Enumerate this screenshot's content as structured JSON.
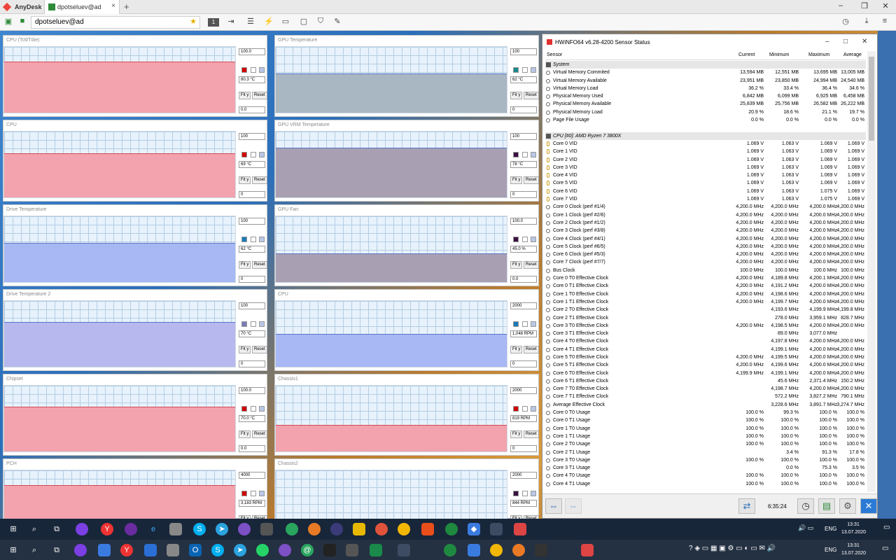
{
  "anydesk": {
    "app_name": "AnyDesk",
    "tab_label": "dpotseluev@ad",
    "address": "dpotseluev@ad",
    "counter": "1"
  },
  "tiles_left": [
    {
      "title": "CPU (Tctl/Tdie)",
      "max": "100.0",
      "current": "80.3 °C",
      "min": "0.0",
      "fit": "Fit y",
      "reset": "Reset",
      "level": 0.78,
      "color": "#f2a3ad",
      "swatch": "#d00000"
    },
    {
      "title": "CPU",
      "max": "100",
      "current": "69 °C",
      "min": "0",
      "fit": "Fit y",
      "reset": "Reset",
      "level": 0.67,
      "color": "#f2a3ad",
      "swatch": "#d00000"
    },
    {
      "title": "Drive Temperature",
      "max": "100",
      "current": "62 °C",
      "min": "0",
      "fit": "Fit y",
      "reset": "Reset",
      "level": 0.6,
      "color": "#a7b8f4",
      "swatch": "#1a7ab8"
    },
    {
      "title": "Drive Temperature 2",
      "max": "100",
      "current": "70 °C",
      "min": "0",
      "fit": "Fit y",
      "reset": "Reset",
      "level": 0.68,
      "color": "#b7b9ee",
      "swatch": "#7a7ab8"
    },
    {
      "title": "Chipset",
      "max": "100.0",
      "current": "70.0 °C",
      "min": "0.0",
      "fit": "Fit y",
      "reset": "Reset",
      "level": 0.68,
      "color": "#f2a3ad",
      "swatch": "#d00000"
    },
    {
      "title": "PCH",
      "max": "4000",
      "current": "3,183 RPM",
      "min": "0",
      "fit": "Fit y",
      "reset": "Reset",
      "level": 0.78,
      "color": "#f2a3ad",
      "swatch": "#d00000"
    }
  ],
  "tiles_right": [
    {
      "title": "GPU Temperature",
      "max": "100",
      "current": "62 °C",
      "min": "0",
      "fit": "Fit y",
      "reset": "Reset",
      "level": 0.6,
      "color": "#a9b7c2",
      "swatch": "#1a8a8a"
    },
    {
      "title": "GPU VRM Temperature",
      "max": "100",
      "current": "78 °C",
      "min": "0",
      "fit": "Fit y",
      "reset": "Reset",
      "level": 0.76,
      "color": "#a8a0b2",
      "swatch": "#3a1040"
    },
    {
      "title": "GPU Fan",
      "max": "100.0",
      "current": "45.0 %",
      "min": "0.0",
      "fit": "Fit y",
      "reset": "Reset",
      "level": 0.44,
      "color": "#a8a0b2",
      "swatch": "#3a1040"
    },
    {
      "title": "CPU",
      "max": "2000",
      "current": "1,048 RPM",
      "min": "0",
      "fit": "Fit y",
      "reset": "Reset",
      "level": 0.5,
      "color": "#a7b8f4",
      "swatch": "#1a7ab8"
    },
    {
      "title": "Chassis1",
      "max": "2000",
      "current": "819 RPM",
      "min": "0",
      "fit": "Fit y",
      "reset": "Reset",
      "level": 0.4,
      "color": "#f2a3ad",
      "swatch": "#d00000"
    },
    {
      "title": "Chassis2",
      "max": "2000",
      "current": "844 RPM",
      "min": "0",
      "fit": "Fit y",
      "reset": "Reset",
      "level": 0.14,
      "color": "#a8a0b2",
      "swatch": "#3a1040"
    }
  ],
  "hwinfo": {
    "title": "HWiNFO64 v6.28-4200 Sensor Status",
    "columns": [
      "Sensor",
      "Current",
      "Minimum",
      "Maximum",
      "Average"
    ],
    "rows": [
      {
        "type": "group",
        "name": "System"
      },
      {
        "icon": "c",
        "name": "Virtual Memory Commited",
        "cur": "13,594 MB",
        "min": "12,551 MB",
        "max": "13,695 MB",
        "avg": "13,005 MB"
      },
      {
        "icon": "c",
        "name": "Virtual Memory Available",
        "cur": "23,951 MB",
        "min": "23,850 MB",
        "max": "24,994 MB",
        "avg": "24,540 MB"
      },
      {
        "icon": "c",
        "name": "Virtual Memory Load",
        "cur": "36.2 %",
        "min": "33.4 %",
        "max": "36.4 %",
        "avg": "34.6 %"
      },
      {
        "icon": "c",
        "name": "Physical Memory Used",
        "cur": "6,842 MB",
        "min": "6,099 MB",
        "max": "6,925 MB",
        "avg": "6,458 MB"
      },
      {
        "icon": "c",
        "name": "Physical Memory Available",
        "cur": "25,839 MB",
        "min": "25,756 MB",
        "max": "26,582 MB",
        "avg": "26,222 MB"
      },
      {
        "icon": "c",
        "name": "Physical Memory Load",
        "cur": "20.9 %",
        "min": "18.6 %",
        "max": "21.1 %",
        "avg": "19.7 %"
      },
      {
        "icon": "c",
        "name": "Page File Usage",
        "cur": "0.0 %",
        "min": "0.0 %",
        "max": "0.0 %",
        "avg": "0.0 %"
      },
      {
        "type": "gap"
      },
      {
        "type": "group",
        "name": "CPU [#0]: AMD Ryzen 7 3800X"
      },
      {
        "icon": "v",
        "name": "Core 0 VID",
        "cur": "1.069 V",
        "min": "1.063 V",
        "max": "1.069 V",
        "avg": "1.069 V"
      },
      {
        "icon": "v",
        "name": "Core 1 VID",
        "cur": "1.069 V",
        "min": "1.063 V",
        "max": "1.069 V",
        "avg": "1.069 V"
      },
      {
        "icon": "v",
        "name": "Core 2 VID",
        "cur": "1.069 V",
        "min": "1.063 V",
        "max": "1.069 V",
        "avg": "1.069 V"
      },
      {
        "icon": "v",
        "name": "Core 3 VID",
        "cur": "1.069 V",
        "min": "1.063 V",
        "max": "1.069 V",
        "avg": "1.069 V"
      },
      {
        "icon": "v",
        "name": "Core 4 VID",
        "cur": "1.069 V",
        "min": "1.063 V",
        "max": "1.069 V",
        "avg": "1.069 V"
      },
      {
        "icon": "v",
        "name": "Core 5 VID",
        "cur": "1.069 V",
        "min": "1.063 V",
        "max": "1.069 V",
        "avg": "1.069 V"
      },
      {
        "icon": "v",
        "name": "Core 6 VID",
        "cur": "1.069 V",
        "min": "1.063 V",
        "max": "1.075 V",
        "avg": "1.069 V"
      },
      {
        "icon": "v",
        "name": "Core 7 VID",
        "cur": "1.069 V",
        "min": "1.063 V",
        "max": "1.075 V",
        "avg": "1.069 V"
      },
      {
        "icon": "c",
        "name": "Core 0 Clock (perf #1/4)",
        "cur": "4,200.0 MHz",
        "min": "4,200.0 MHz",
        "max": "4,200.0 MHz",
        "avg": "4,200.0 MHz"
      },
      {
        "icon": "c",
        "name": "Core 1 Clock (perf #2/6)",
        "cur": "4,200.0 MHz",
        "min": "4,200.0 MHz",
        "max": "4,200.0 MHz",
        "avg": "4,200.0 MHz"
      },
      {
        "icon": "c",
        "name": "Core 2 Clock (perf #1/2)",
        "cur": "4,200.0 MHz",
        "min": "4,200.0 MHz",
        "max": "4,200.0 MHz",
        "avg": "4,200.0 MHz"
      },
      {
        "icon": "c",
        "name": "Core 3 Clock (perf #3/8)",
        "cur": "4,200.0 MHz",
        "min": "4,200.0 MHz",
        "max": "4,200.0 MHz",
        "avg": "4,200.0 MHz"
      },
      {
        "icon": "c",
        "name": "Core 4 Clock (perf #4/1)",
        "cur": "4,200.0 MHz",
        "min": "4,200.0 MHz",
        "max": "4,200.0 MHz",
        "avg": "4,200.0 MHz"
      },
      {
        "icon": "c",
        "name": "Core 5 Clock (perf #6/5)",
        "cur": "4,200.0 MHz",
        "min": "4,200.0 MHz",
        "max": "4,200.0 MHz",
        "avg": "4,200.0 MHz"
      },
      {
        "icon": "c",
        "name": "Core 6 Clock (perf #5/3)",
        "cur": "4,200.0 MHz",
        "min": "4,200.0 MHz",
        "max": "4,200.0 MHz",
        "avg": "4,200.0 MHz"
      },
      {
        "icon": "c",
        "name": "Core 7 Clock (perf #7/7)",
        "cur": "4,200.0 MHz",
        "min": "4,200.0 MHz",
        "max": "4,200.0 MHz",
        "avg": "4,200.0 MHz"
      },
      {
        "icon": "c",
        "name": "Bus Clock",
        "cur": "100.0 MHz",
        "min": "100.0 MHz",
        "max": "100.0 MHz",
        "avg": "100.0 MHz"
      },
      {
        "icon": "c",
        "name": "Core 0 T0 Effective Clock",
        "cur": "4,200.0 MHz",
        "min": "4,189.8 MHz",
        "max": "4,200.1 MHz",
        "avg": "4,200.0 MHz"
      },
      {
        "icon": "c",
        "name": "Core 0 T1 Effective Clock",
        "cur": "4,200.0 MHz",
        "min": "4,191.2 MHz",
        "max": "4,200.0 MHz",
        "avg": "4,200.0 MHz"
      },
      {
        "icon": "c",
        "name": "Core 1 T0 Effective Clock",
        "cur": "4,200.0 MHz",
        "min": "4,198.6 MHz",
        "max": "4,200.0 MHz",
        "avg": "4,200.0 MHz"
      },
      {
        "icon": "c",
        "name": "Core 1 T1 Effective Clock",
        "cur": "4,200.0 MHz",
        "min": "4,199.7 MHz",
        "max": "4,200.0 MHz",
        "avg": "4,200.0 MHz"
      },
      {
        "icon": "c",
        "name": "Core 2 T0 Effective Clock",
        "cur": "",
        "min": "4,193.6 MHz",
        "max": "4,199.9 MHz",
        "avg": "4,199.8 MHz"
      },
      {
        "icon": "c",
        "name": "Core 2 T1 Effective Clock",
        "cur": "",
        "min": "278.0 MHz",
        "max": "3,959.1 MHz",
        "avg": "828.7 MHz"
      },
      {
        "icon": "c",
        "name": "Core 3 T0 Effective Clock",
        "cur": "4,200.0 MHz",
        "min": "4,198.5 MHz",
        "max": "4,200.0 MHz",
        "avg": "4,200.0 MHz"
      },
      {
        "icon": "c",
        "name": "Core 3 T1 Effective Clock",
        "cur": "",
        "min": "89.0 MHz",
        "max": "3,077.0 MHz",
        "avg": ""
      },
      {
        "icon": "c",
        "name": "Core 4 T0 Effective Clock",
        "cur": "",
        "min": "4,197.8 MHz",
        "max": "4,200.0 MHz",
        "avg": "4,200.0 MHz"
      },
      {
        "icon": "c",
        "name": "Core 4 T1 Effective Clock",
        "cur": "",
        "min": "4,199.1 MHz",
        "max": "4,200.0 MHz",
        "avg": "4,200.0 MHz"
      },
      {
        "icon": "c",
        "name": "Core 5 T0 Effective Clock",
        "cur": "4,200.0 MHz",
        "min": "4,199.5 MHz",
        "max": "4,200.0 MHz",
        "avg": "4,200.0 MHz"
      },
      {
        "icon": "c",
        "name": "Core 5 T1 Effective Clock",
        "cur": "4,200.0 MHz",
        "min": "4,199.6 MHz",
        "max": "4,200.0 MHz",
        "avg": "4,200.0 MHz"
      },
      {
        "icon": "c",
        "name": "Core 6 T0 Effective Clock",
        "cur": "4,199.9 MHz",
        "min": "4,199.1 MHz",
        "max": "4,200.0 MHz",
        "avg": "4,200.0 MHz"
      },
      {
        "icon": "c",
        "name": "Core 6 T1 Effective Clock",
        "cur": "",
        "min": "45.6 MHz",
        "max": "2,371.4 MHz",
        "avg": "150.2 MHz"
      },
      {
        "icon": "c",
        "name": "Core 7 T0 Effective Clock",
        "cur": "",
        "min": "4,198.7 MHz",
        "max": "4,200.0 MHz",
        "avg": "4,200.0 MHz"
      },
      {
        "icon": "c",
        "name": "Core 7 T1 Effective Clock",
        "cur": "",
        "min": "572.2 MHz",
        "max": "3,827.2 MHz",
        "avg": "790.1 MHz"
      },
      {
        "icon": "c",
        "name": "Average Effective Clock",
        "cur": "",
        "min": "3,228.6 MHz",
        "max": "3,891.7 MHz",
        "avg": "3,274.7 MHz"
      },
      {
        "icon": "c",
        "name": "Core 0 T0 Usage",
        "cur": "100.0 %",
        "min": "99.3 %",
        "max": "100.0 %",
        "avg": "100.0 %"
      },
      {
        "icon": "c",
        "name": "Core 0 T1 Usage",
        "cur": "100.0 %",
        "min": "100.0 %",
        "max": "100.0 %",
        "avg": "100.0 %"
      },
      {
        "icon": "c",
        "name": "Core 1 T0 Usage",
        "cur": "100.0 %",
        "min": "100.0 %",
        "max": "100.0 %",
        "avg": "100.0 %"
      },
      {
        "icon": "c",
        "name": "Core 1 T1 Usage",
        "cur": "100.0 %",
        "min": "100.0 %",
        "max": "100.0 %",
        "avg": "100.0 %"
      },
      {
        "icon": "c",
        "name": "Core 2 T0 Usage",
        "cur": "100.0 %",
        "min": "100.0 %",
        "max": "100.0 %",
        "avg": "100.0 %"
      },
      {
        "icon": "c",
        "name": "Core 2 T1 Usage",
        "cur": "",
        "min": "3.4 %",
        "max": "91.3 %",
        "avg": "17.8 %"
      },
      {
        "icon": "c",
        "name": "Core 3 T0 Usage",
        "cur": "100.0 %",
        "min": "100.0 %",
        "max": "100.0 %",
        "avg": "100.0 %"
      },
      {
        "icon": "c",
        "name": "Core 3 T1 Usage",
        "cur": "",
        "min": "0.0 %",
        "max": "75.3 %",
        "avg": "3.5 %"
      },
      {
        "icon": "c",
        "name": "Core 4 T0 Usage",
        "cur": "100.0 %",
        "min": "100.0 %",
        "max": "100.0 %",
        "avg": "100.0 %"
      },
      {
        "icon": "c",
        "name": "Core 4 T1 Usage",
        "cur": "100.0 %",
        "min": "100.0 %",
        "max": "100.0 %",
        "avg": "100.0 %"
      }
    ],
    "elapsed_time": "6:35:24"
  },
  "taskbar_remote": {
    "lang": "ENG",
    "time": "13:31",
    "date": "13.07.2020"
  },
  "taskbar_local": {
    "lang": "ENG",
    "time": "13:31",
    "date": "13.07.2020"
  }
}
